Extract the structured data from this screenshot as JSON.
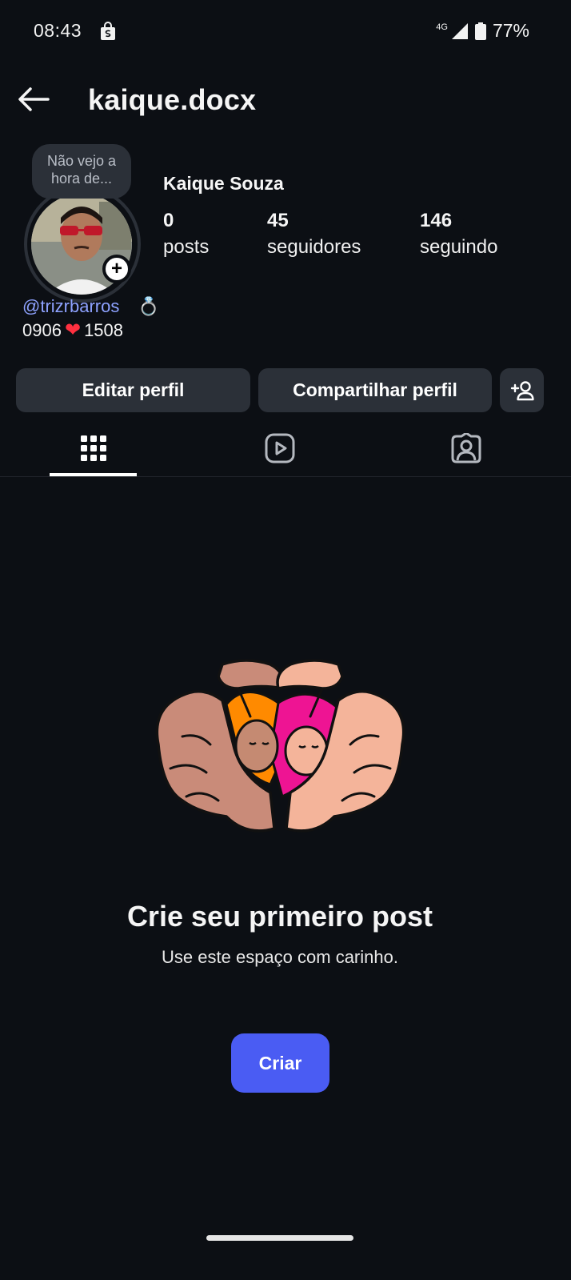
{
  "status_bar": {
    "time": "08:43",
    "network": "4G",
    "battery": "77%"
  },
  "header": {
    "username": "kaique.docx"
  },
  "profile": {
    "note": "Não vejo a hora de...",
    "display_name": "Kaique Souza",
    "stats": [
      {
        "value": "0",
        "label": "posts"
      },
      {
        "value": "45",
        "label": "seguidores"
      },
      {
        "value": "146",
        "label": "seguindo"
      }
    ],
    "bio_link": "@trizrbarros",
    "bio_emoji": "💍",
    "bio_line2_left": "0906",
    "bio_line2_heart": "❤",
    "bio_line2_right": "1508"
  },
  "actions": {
    "edit": "Editar perfil",
    "share": "Compartilhar perfil"
  },
  "tabs": [
    "grid-icon",
    "reels-icon",
    "tagged-icon"
  ],
  "empty_state": {
    "title": "Crie seu primeiro post",
    "subtitle": "Use este espaço com carinho.",
    "button": "Criar"
  },
  "colors": {
    "background": "#0c0f14",
    "button": "#2b3038",
    "accent": "#4a5cf3",
    "link": "#8ea2ff"
  }
}
